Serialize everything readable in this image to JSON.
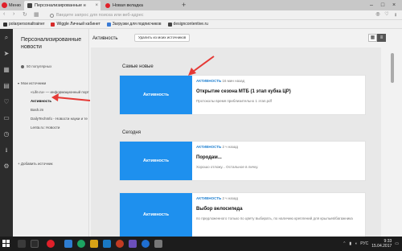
{
  "browser": {
    "menu_label": "Меню",
    "tabs": [
      {
        "label": "Персонализированные н"
      },
      {
        "label": "Новая вкладка"
      }
    ],
    "address_placeholder": "Введите запрос для поиска или веб-адрес",
    "bookmarks": [
      {
        "label": "polarpersonaltrainer"
      },
      {
        "label": "Wiggle Личный кабинет"
      },
      {
        "label": "Загрузки для подписчиков"
      },
      {
        "label": "designcontentive.ru"
      }
    ]
  },
  "sidebar": {
    "title": "Персонализированные новости",
    "popular_label": "50 популярных",
    "sources_label": "Мои источники",
    "sources": [
      {
        "label": "«Life.ru» — информационный портал"
      },
      {
        "label": "Активность"
      },
      {
        "label": "Bash.im"
      },
      {
        "label": "DailyTechInfo - Новости науки и те"
      },
      {
        "label": "Lenta.ru: Новости"
      }
    ],
    "add_source_label": "Добавить источник"
  },
  "main": {
    "title": "Активность",
    "remove_label": "Удалить из моих источников",
    "sections": [
      {
        "label": "Самые новые"
      },
      {
        "label": "Сегодня"
      }
    ],
    "cards": [
      {
        "thumb_label": "Активность",
        "source": "АКТИВНОСТЬ",
        "time": "16 мин назад",
        "title": "Открытие сезона МТБ (1 этап кубка ЦР)",
        "desc": "Протоколы время приблизительно 1 этап.pdf"
      },
      {
        "thumb_label": "Активность",
        "source": "АКТИВНОСТЬ",
        "time": "2 ч назад",
        "title": "Породам...",
        "desc": "Хорошо отложу... Остальное в личку."
      },
      {
        "thumb_label": "Активность",
        "source": "АКТИВНОСТЬ",
        "time": "2 ч назад",
        "title": "Выбор велосипеда",
        "desc": "по предложенного только по цвету выбирать, по наличию креплений для крыльев/багажника"
      }
    ]
  },
  "taskbar": {
    "lang": "РУС",
    "time": "9:33",
    "date": "15.04.2017"
  },
  "colors": {
    "accent": "#1e90ee",
    "annotation": "#e53935"
  }
}
